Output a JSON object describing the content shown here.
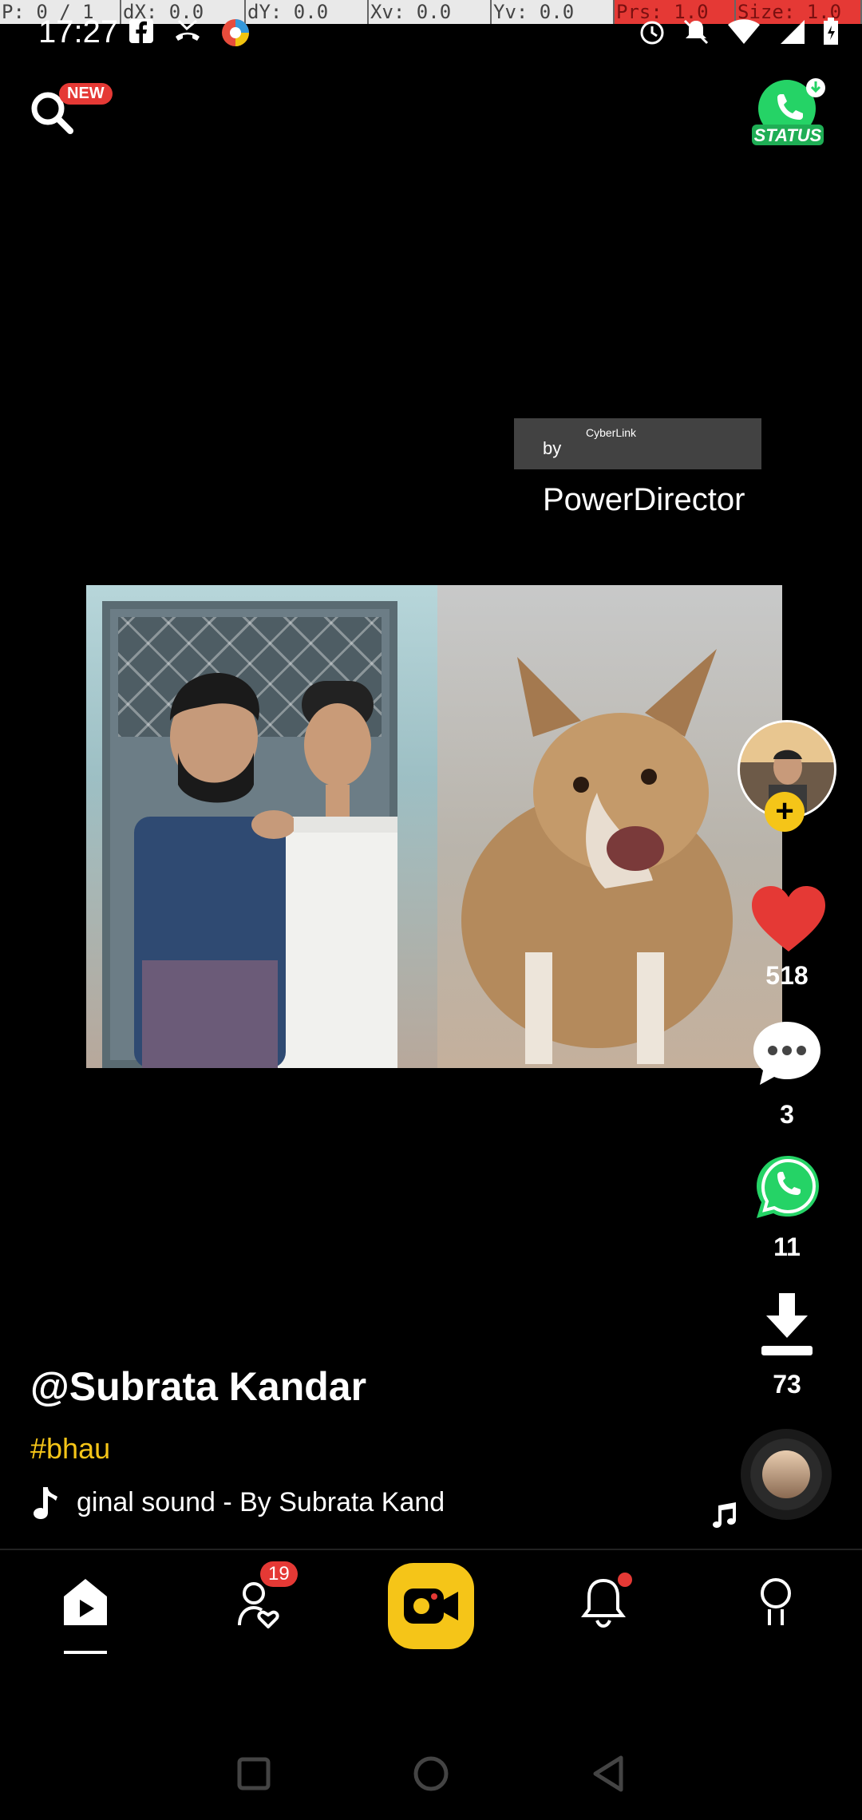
{
  "debug_overlay": [
    "P: 0 / 1",
    "dX: 0.0",
    "dY: 0.0",
    "Xv: 0.0",
    "Yv: 0.0",
    "Prs: 1.0",
    "Size: 1.0"
  ],
  "status_bar": {
    "time": "17:27"
  },
  "header": {
    "search_badge": "NEW",
    "status_label": "STATUS"
  },
  "video": {
    "watermark_by": "by",
    "watermark_brand": "PowerDirector",
    "watermark_small": "CyberLink"
  },
  "actions": {
    "likes": "518",
    "comments": "3",
    "shares": "11",
    "downloads": "73"
  },
  "post": {
    "username": "@Subrata Kandar",
    "hashtag": "#bhau",
    "sound": "ginal sound - By Subrata Kand"
  },
  "bottom_nav": {
    "follow_badge": "19"
  },
  "colors": {
    "accent": "#f5c518",
    "like": "#e53935",
    "whatsapp": "#25d366"
  }
}
